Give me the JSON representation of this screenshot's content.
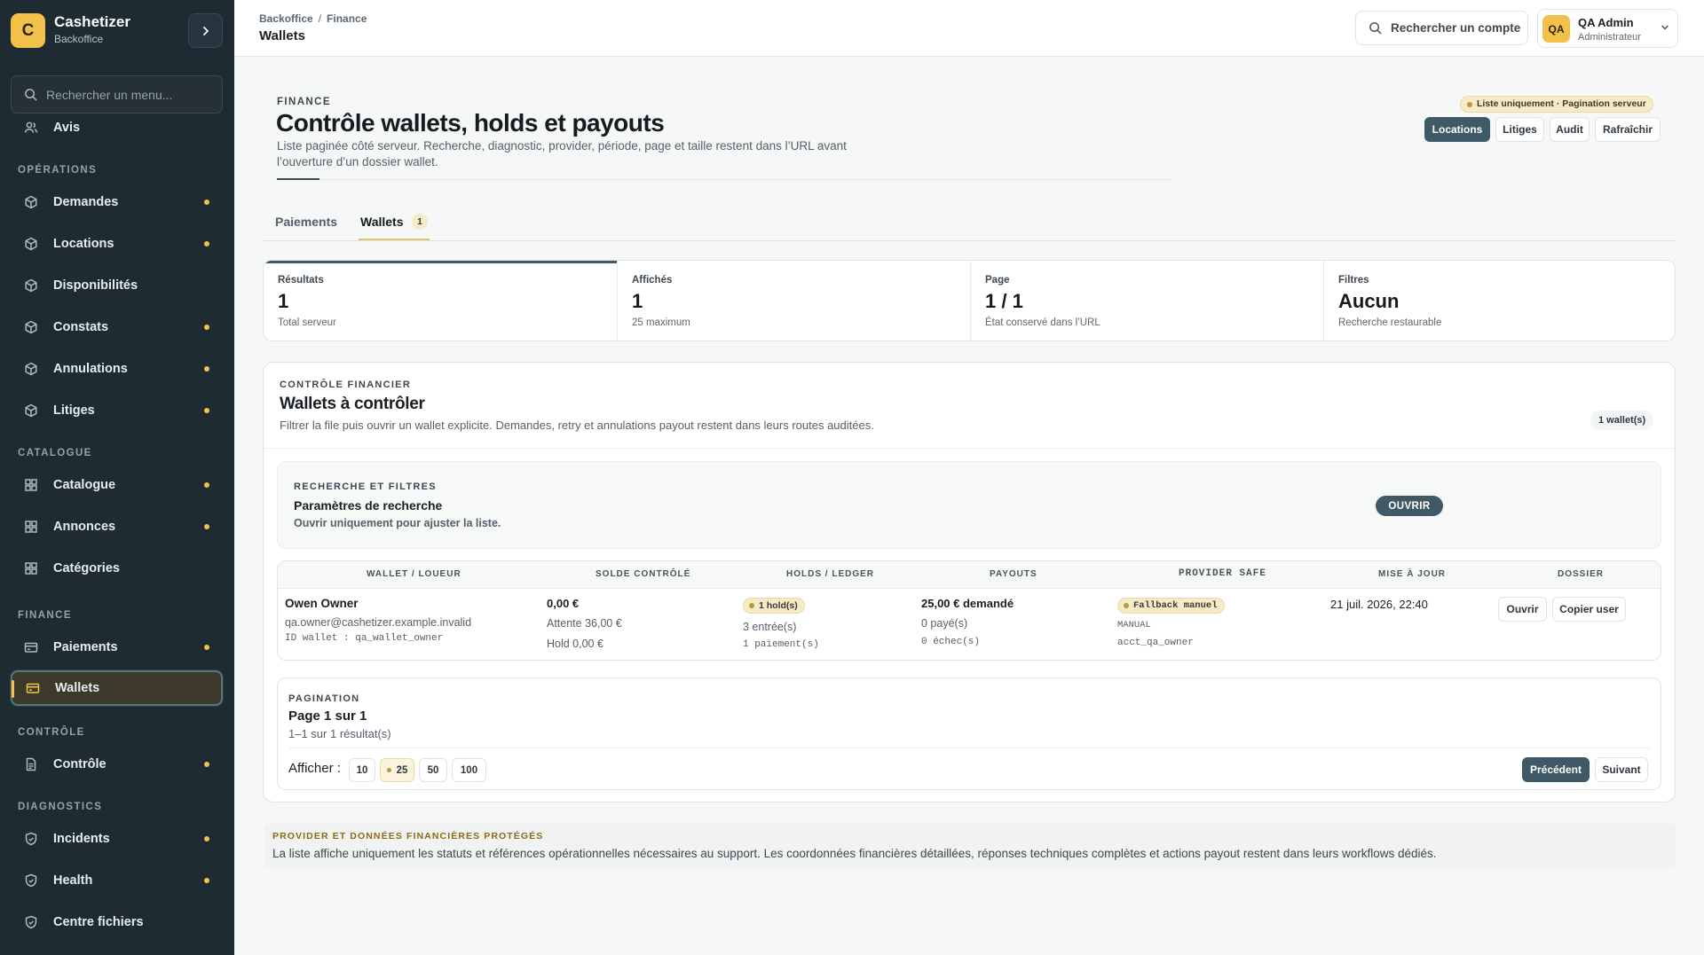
{
  "app": {
    "name": "Cashetizer",
    "subtitle": "Backoffice",
    "logo_letter": "C"
  },
  "sidebar": {
    "search_placeholder": "Rechercher un menu...",
    "top_item": {
      "label": "Avis",
      "icon": "users-icon"
    },
    "sections": [
      {
        "title": "OPÉRATIONS",
        "items": [
          {
            "label": "Demandes",
            "icon": "box-icon",
            "dot": true
          },
          {
            "label": "Locations",
            "icon": "box-icon",
            "dot": true
          },
          {
            "label": "Disponibilités",
            "icon": "box-icon",
            "dot": false
          },
          {
            "label": "Constats",
            "icon": "box-icon",
            "dot": true
          },
          {
            "label": "Annulations",
            "icon": "box-icon",
            "dot": true
          },
          {
            "label": "Litiges",
            "icon": "box-icon",
            "dot": true
          }
        ]
      },
      {
        "title": "CATALOGUE",
        "items": [
          {
            "label": "Catalogue",
            "icon": "grid-icon",
            "dot": true
          },
          {
            "label": "Annonces",
            "icon": "grid-icon",
            "dot": true
          },
          {
            "label": "Catégories",
            "icon": "grid-icon",
            "dot": false
          }
        ]
      },
      {
        "title": "FINANCE",
        "items": [
          {
            "label": "Paiements",
            "icon": "card-icon",
            "dot": true
          },
          {
            "label": "Wallets",
            "icon": "card-icon",
            "dot": false,
            "active": true
          }
        ]
      },
      {
        "title": "CONTRÔLE",
        "items": [
          {
            "label": "Contrôle",
            "icon": "document-icon",
            "dot": true
          }
        ]
      },
      {
        "title": "DIAGNOSTICS",
        "items": [
          {
            "label": "Incidents",
            "icon": "shield-icon",
            "dot": true
          },
          {
            "label": "Health",
            "icon": "shield-icon",
            "dot": true
          },
          {
            "label": "Centre fichiers",
            "icon": "shield-icon",
            "dot": false
          }
        ]
      }
    ]
  },
  "topbar": {
    "breadcrumb": [
      "Backoffice",
      "Finance"
    ],
    "breadcrumb_sep": "/",
    "title": "Wallets",
    "account_search": "Rechercher un compte",
    "user": {
      "initials": "QA",
      "name": "QA Admin",
      "role": "Administrateur"
    }
  },
  "header": {
    "kicker": "FINANCE",
    "title": "Contrôle wallets, holds et payouts",
    "description": "Liste paginée côté serveur. Recherche, diagnostic, provider, période, page et taille restent dans l’URL avant l’ouverture d’un dossier wallet.",
    "badge": "Liste uniquement · Pagination serveur",
    "actions": [
      "Locations",
      "Litiges",
      "Audit",
      "Rafraîchir"
    ]
  },
  "tabs": [
    {
      "label": "Paiements"
    },
    {
      "label": "Wallets",
      "count": "1",
      "active": true
    }
  ],
  "stats": [
    {
      "label": "Résultats",
      "value": "1",
      "sub": "Total serveur"
    },
    {
      "label": "Affichés",
      "value": "1",
      "sub": "25 maximum"
    },
    {
      "label": "Page",
      "value": "1 / 1",
      "sub": "État conservé dans l’URL"
    },
    {
      "label": "Filtres",
      "value": "Aucun",
      "sub": "Recherche restaurable"
    }
  ],
  "panel": {
    "kicker": "CONTRÔLE FINANCIER",
    "title": "Wallets à contrôler",
    "description": "Filtrer la file puis ouvrir un wallet explicite. Demandes, retry et annulations payout restent dans leurs routes auditées.",
    "count": "1 wallet(s)",
    "filters": {
      "kicker": "RECHERCHE ET FILTRES",
      "title": "Paramètres de recherche",
      "description": "Ouvrir uniquement pour ajuster la liste.",
      "open_label": "OUVRIR"
    },
    "table": {
      "headers": [
        "WALLET / LOUEUR",
        "SOLDE CONTRÔLÉ",
        "HOLDS / LEDGER",
        "PAYOUTS",
        "PROVIDER SAFE",
        "MISE À JOUR",
        "DOSSIER"
      ],
      "row": {
        "owner": "Owen Owner",
        "email": "qa.owner@cashetizer.example.invalid",
        "wallet_id": "ID wallet : qa_wallet_owner",
        "balance": "0,00 €",
        "pending": "Attente 36,00 €",
        "hold": "Hold 0,00 €",
        "holds_chip": "1 hold(s)",
        "entries": "3 entrée(s)",
        "payments": "1 paiement(s)",
        "payout_requested": "25,00 € demandé",
        "payout_paid": "0 payé(s)",
        "payout_failed": "0 échec(s)",
        "provider_chip": "Fallback manuel",
        "provider_mode": "MANUAL",
        "provider_account": "acct_qa_owner",
        "updated": "21 juil. 2026, 22:40",
        "actions": [
          "Ouvrir",
          "Copier user"
        ]
      }
    },
    "pagination": {
      "kicker": "PAGINATION",
      "title": "Page 1 sur 1",
      "subtitle": "1–1 sur 1 résultat(s)",
      "show_label": "Afficher :",
      "sizes": [
        "10",
        "25",
        "50",
        "100"
      ],
      "selected_size": "25",
      "prev": "Précédent",
      "next": "Suivant"
    }
  },
  "notice": {
    "kicker": "PROVIDER ET DONNÉES FINANCIÈRES PROTÉGÉS",
    "text": "La liste affiche uniquement les statuts et références opérationnelles nécessaires au support. Les coordonnées financières détaillées, réponses techniques complètes et actions payout restent dans leurs workflows dédiés."
  },
  "colors": {
    "sidebar_bg": "#1f2b33",
    "accent_yellow": "#f3c14a",
    "primary_button": "#3f5a66"
  }
}
